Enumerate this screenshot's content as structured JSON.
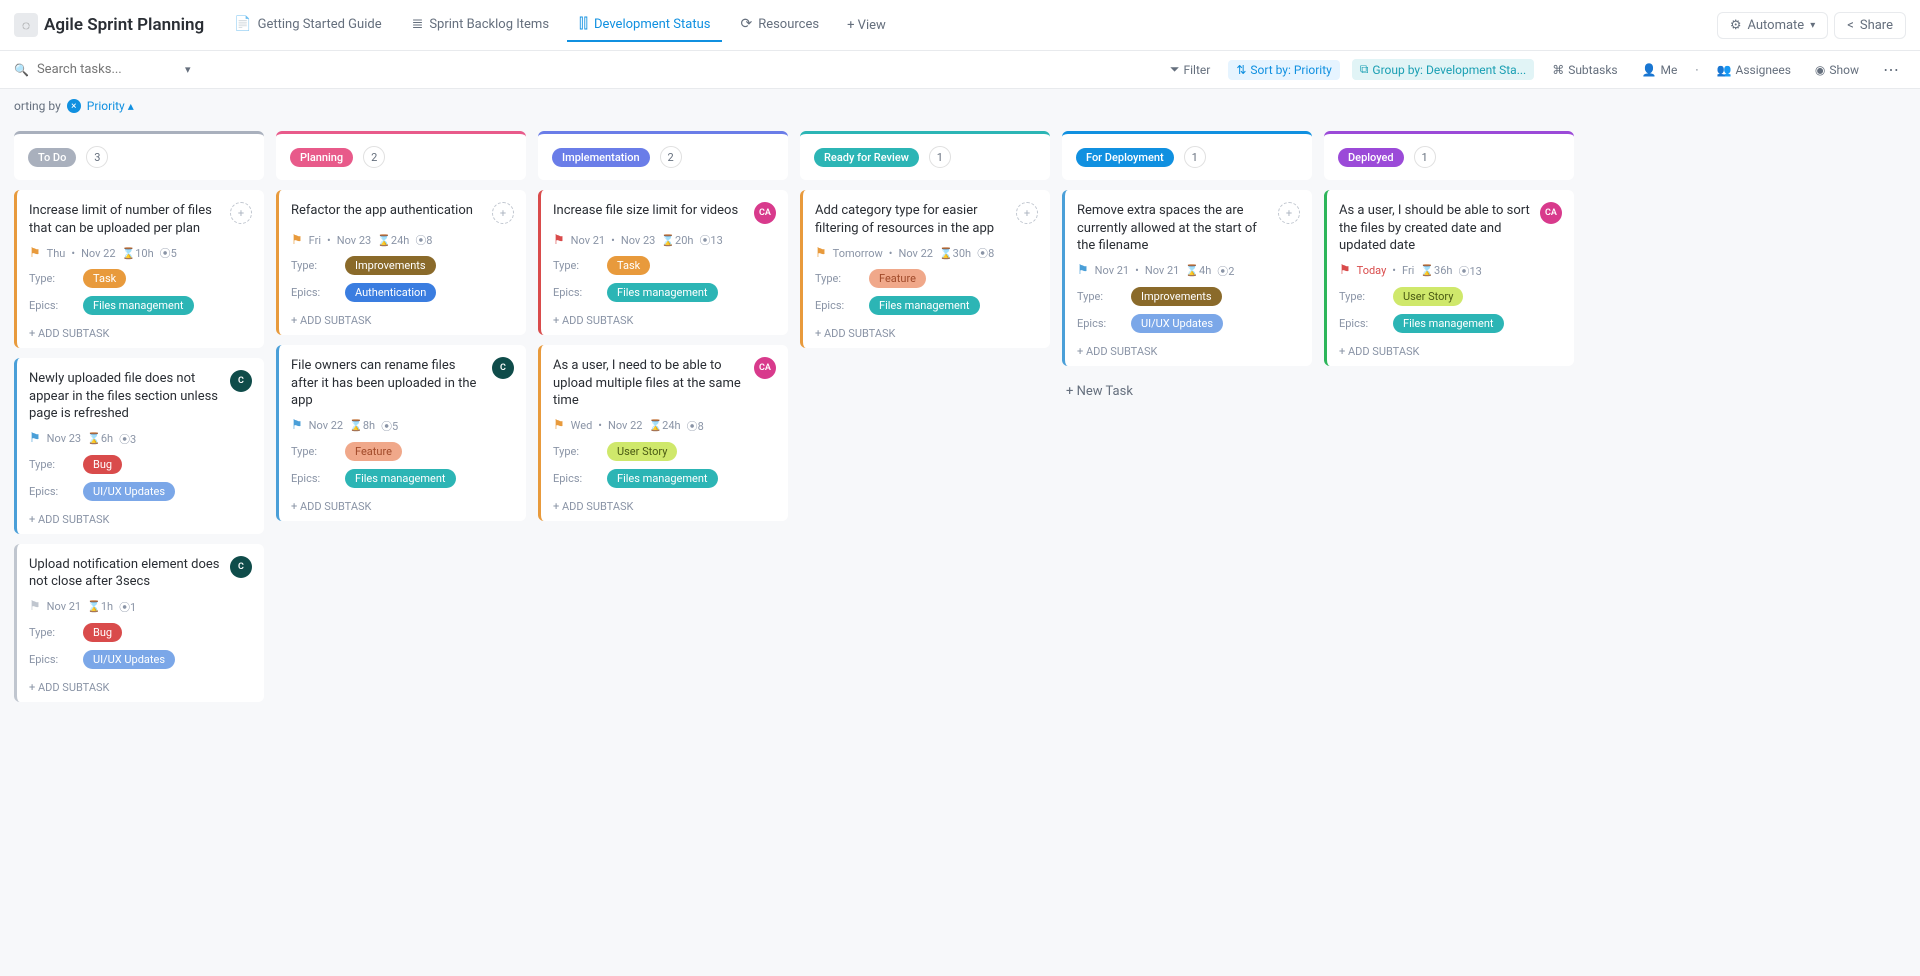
{
  "header": {
    "project_title": "Agile Sprint Planning",
    "tabs": [
      {
        "label": "Getting Started Guide",
        "icon": "📄"
      },
      {
        "label": "Sprint Backlog Items",
        "icon": "≣"
      },
      {
        "label": "Development Status",
        "icon": "⫿⫿",
        "active": true
      },
      {
        "label": "Resources",
        "icon": "⟳"
      }
    ],
    "add_view": "+ View",
    "automate": "Automate",
    "share": "Share"
  },
  "toolbar": {
    "search_placeholder": "Search tasks...",
    "filter": "Filter",
    "sort_by": "Sort by: Priority",
    "group_by": "Group by: Development Sta...",
    "subtasks": "Subtasks",
    "me": "Me",
    "assignees": "Assignees",
    "show": "Show"
  },
  "sortrow": {
    "prefix": "orting by",
    "label": "Priority"
  },
  "labels": {
    "type": "Type:",
    "epics": "Epics:",
    "add_subtask": "+ ADD SUBTASK",
    "new_task": "+ New Task"
  },
  "columns": [
    {
      "name": "To Do",
      "color": "#a9b0bd",
      "count": "3",
      "cards": [
        {
          "title": "Increase limit of number of files that can be uploaded per plan",
          "priority_color": "#e89a3c",
          "flag": "🚩",
          "flag_color": "#e89a3c",
          "avatar": "dashed",
          "meta": [
            "Thu",
            "•",
            "Nov 22",
            "⌛10h",
            "⦿5"
          ],
          "type": {
            "text": "Task",
            "cls": "tag-task"
          },
          "epics": {
            "text": "Files management",
            "cls": "tag-files"
          }
        },
        {
          "title": "Newly uploaded file does not appear in the files section unless page is refreshed",
          "priority_color": "#4a9fd8",
          "flag": "🚩",
          "flag_color": "#4a9fd8",
          "avatar": "teal",
          "avatar_text": "C",
          "meta": [
            "Nov 23",
            "⌛6h",
            "⦿3"
          ],
          "type": {
            "text": "Bug",
            "cls": "tag-bug"
          },
          "epics": {
            "text": "UI/UX Updates",
            "cls": "tag-uiux"
          }
        },
        {
          "title": "Upload notification element does not close after 3secs",
          "priority_color": "#c0c6cf",
          "flag": "🚩",
          "flag_color": "#c0c6cf",
          "avatar": "teal",
          "avatar_text": "C",
          "meta": [
            "Nov 21",
            "⌛1h",
            "⦿1"
          ],
          "type": {
            "text": "Bug",
            "cls": "tag-bug"
          },
          "epics": {
            "text": "UI/UX Updates",
            "cls": "tag-uiux"
          }
        }
      ]
    },
    {
      "name": "Planning",
      "color": "#e85a8a",
      "count": "2",
      "cards": [
        {
          "title": "Refactor the app authentication",
          "priority_color": "#e89a3c",
          "flag": "🚩",
          "flag_color": "#e89a3c",
          "avatar": "dashed",
          "meta": [
            "Fri",
            "•",
            "Nov 23",
            "⌛24h",
            "⦿8"
          ],
          "type": {
            "text": "Improvements",
            "cls": "tag-improv"
          },
          "epics": {
            "text": "Authentication",
            "cls": "tag-auth"
          }
        },
        {
          "title": "File owners can rename files after it has been uploaded in the app",
          "priority_color": "#4a9fd8",
          "flag": "🚩",
          "flag_color": "#4a9fd8",
          "avatar": "teal",
          "avatar_text": "C",
          "meta": [
            "Nov 22",
            "⌛8h",
            "⦿5"
          ],
          "type": {
            "text": "Feature",
            "cls": "tag-feature"
          },
          "epics": {
            "text": "Files management",
            "cls": "tag-files"
          }
        }
      ]
    },
    {
      "name": "Implementation",
      "color": "#6a7de8",
      "count": "2",
      "cards": [
        {
          "title": "Increase file size limit for videos",
          "priority_color": "#d94b4b",
          "flag": "🚩",
          "flag_color": "#d94b4b",
          "avatar": "pink",
          "avatar_text": "CA",
          "meta": [
            "Nov 21",
            "•",
            "Nov 23",
            "⌛20h",
            "⦿13"
          ],
          "type": {
            "text": "Task",
            "cls": "tag-task"
          },
          "epics": {
            "text": "Files management",
            "cls": "tag-files"
          }
        },
        {
          "title": "As a user, I need to be able to upload multiple files at the same time",
          "priority_color": "#e89a3c",
          "flag": "🚩",
          "flag_color": "#e89a3c",
          "avatar": "pink",
          "avatar_text": "CA",
          "meta": [
            "Wed",
            "•",
            "Nov 22",
            "⌛24h",
            "⦿8"
          ],
          "type": {
            "text": "User Story",
            "cls": "tag-userstory"
          },
          "epics": {
            "text": "Files management",
            "cls": "tag-files"
          }
        }
      ]
    },
    {
      "name": "Ready for Review",
      "color": "#2cb5b5",
      "count": "1",
      "cards": [
        {
          "title": "Add category type for easier filtering of resources in the app",
          "priority_color": "#e89a3c",
          "flag": "🚩",
          "flag_color": "#e89a3c",
          "avatar": "dashed",
          "meta": [
            "Tomorrow",
            "•",
            "Nov 22",
            "⌛30h",
            "⦿8"
          ],
          "type": {
            "text": "Feature",
            "cls": "tag-feature"
          },
          "epics": {
            "text": "Files management",
            "cls": "tag-files"
          }
        }
      ]
    },
    {
      "name": "For Deployment",
      "color": "#1090e0",
      "count": "1",
      "cards": [
        {
          "title": "Remove extra spaces the are currently allowed at the start of the filename",
          "priority_color": "#4a9fd8",
          "flag": "🚩",
          "flag_color": "#4a9fd8",
          "avatar": "dashed",
          "meta": [
            "Nov 21",
            "•",
            "Nov 21",
            "⌛4h",
            "⦿2"
          ],
          "type": {
            "text": "Improvements",
            "cls": "tag-improv"
          },
          "epics": {
            "text": "UI/UX Updates",
            "cls": "tag-uiux"
          }
        }
      ],
      "show_new": true
    },
    {
      "name": "Deployed",
      "color": "#9b4ad8",
      "count": "1",
      "cards": [
        {
          "title": "As a user, I should be able to sort the files by created date and updated date",
          "priority_color": "#2cb55a",
          "flag": "🚩",
          "flag_color": "#d94b4b",
          "avatar": "pink",
          "avatar_text": "CA",
          "meta_colored": [
            {
              "t": "Today",
              "c": "#d94b4b"
            },
            {
              "t": "•"
            },
            {
              "t": "Fri"
            },
            {
              "t": "⌛36h"
            },
            {
              "t": "⦿13"
            }
          ],
          "type": {
            "text": "User Story",
            "cls": "tag-userstory"
          },
          "epics": {
            "text": "Files management",
            "cls": "tag-files"
          }
        }
      ]
    }
  ]
}
